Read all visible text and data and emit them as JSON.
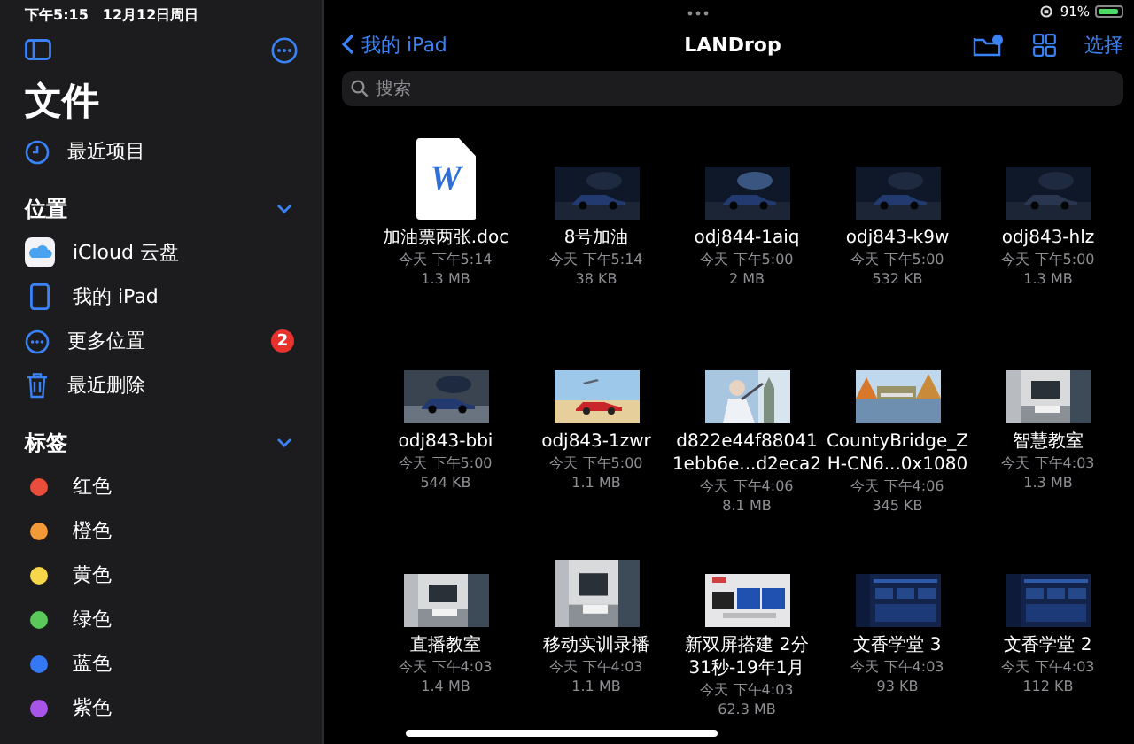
{
  "status_bar": {
    "time": "下午5:15",
    "date": "12月12日周日",
    "battery": "91%"
  },
  "sidebar": {
    "title": "文件",
    "recents": {
      "label": "最近项目"
    },
    "sections": [
      {
        "title": "位置",
        "expanded": true,
        "items": [
          {
            "kind": "icloud",
            "label": "iCloud 云盘"
          },
          {
            "kind": "ipad",
            "label": "我的 iPad"
          },
          {
            "kind": "more",
            "label": "更多位置",
            "badge": "2"
          },
          {
            "kind": "trash",
            "label": "最近删除"
          }
        ]
      },
      {
        "title": "标签",
        "expanded": true,
        "items": [
          {
            "kind": "tag",
            "label": "红色",
            "color": "#eb4d3d"
          },
          {
            "kind": "tag",
            "label": "橙色",
            "color": "#f19a37"
          },
          {
            "kind": "tag",
            "label": "黄色",
            "color": "#f7d74a"
          },
          {
            "kind": "tag",
            "label": "绿色",
            "color": "#5ac85a"
          },
          {
            "kind": "tag",
            "label": "蓝色",
            "color": "#3478f6"
          },
          {
            "kind": "tag",
            "label": "紫色",
            "color": "#a854e8"
          }
        ]
      }
    ]
  },
  "nav": {
    "back": "我的 iPad",
    "title": "LANDrop",
    "select": "选择"
  },
  "search": {
    "placeholder": "搜索"
  },
  "files": [
    {
      "kind": "doc",
      "badge": "W",
      "name": [
        "加油票两张.doc"
      ],
      "date": "今天 下午5:14",
      "size": "1.3 MB"
    },
    {
      "kind": "picture",
      "name": [
        "8号加油"
      ],
      "date": "今天 下午5:14",
      "size": "38 KB"
    },
    {
      "kind": "picture",
      "name": [
        "odj844-1aiq"
      ],
      "date": "今天 下午5:00",
      "size": "2 MB"
    },
    {
      "kind": "picture",
      "name": [
        "odj843-k9w"
      ],
      "date": "今天 下午5:00",
      "size": "532 KB"
    },
    {
      "kind": "picture",
      "name": [
        "odj843-hlz"
      ],
      "date": "今天 下午5:00",
      "size": "1.3 MB"
    },
    {
      "kind": "picture",
      "name": [
        "odj843-bbi"
      ],
      "date": "今天 下午5:00",
      "size": "544 KB"
    },
    {
      "kind": "picture",
      "name": [
        "odj843-1zwr"
      ],
      "date": "今天 下午5:00",
      "size": "1.1 MB"
    },
    {
      "kind": "picture",
      "name": [
        "d822e44f88041",
        "1ebb6e...d2eca2"
      ],
      "date": "今天 下午4:06",
      "size": "8.1 MB"
    },
    {
      "kind": "picture",
      "name": [
        "CountyBridge_Z",
        "H-CN6...0x1080"
      ],
      "date": "今天 下午4:06",
      "size": "345 KB"
    },
    {
      "kind": "picture",
      "name": [
        "智慧教室"
      ],
      "date": "今天 下午4:03",
      "size": "1.3 MB"
    },
    {
      "kind": "picture",
      "name": [
        "直播教室"
      ],
      "date": "今天 下午4:03",
      "size": "1.4 MB"
    },
    {
      "kind": "picture",
      "name": [
        "移动实训录播"
      ],
      "date": "今天 下午4:03",
      "size": "1.1 MB"
    },
    {
      "kind": "picture",
      "name": [
        "新双屏搭建 2分",
        "31秒-19年1月"
      ],
      "date": "今天 下午4:03",
      "size": "62.3 MB"
    },
    {
      "kind": "picture",
      "name": [
        "文香学堂 3"
      ],
      "date": "今天 下午4:03",
      "size": "93 KB"
    },
    {
      "kind": "picture",
      "name": [
        "文香学堂 2"
      ],
      "date": "今天 下午4:03",
      "size": "112 KB"
    }
  ]
}
